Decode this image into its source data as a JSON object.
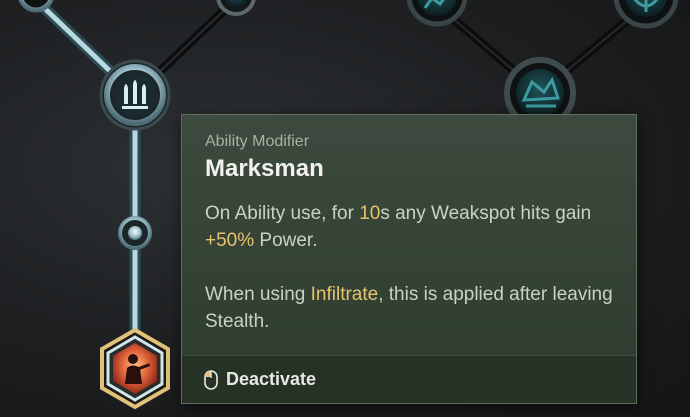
{
  "tooltip": {
    "type_label": "Ability Modifier",
    "title": "Marksman",
    "line1": {
      "t1": "On Ability use, for ",
      "h1": "10",
      "t2": "s any Weakspot hits gain ",
      "h2": "+50%",
      "t3": " Power."
    },
    "line2": {
      "t1": "When using ",
      "h1": "Infiltrate",
      "t2": ", this is applied after leaving Stealth."
    },
    "footer": {
      "icon": "mouse-left-click-icon",
      "label": "Deactivate"
    }
  },
  "skill_tree": {
    "nodes": [
      {
        "name": "top-left-node",
        "state": "active"
      },
      {
        "name": "top-mid-node",
        "state": "locked"
      },
      {
        "name": "top-right-node-1",
        "state": "locked"
      },
      {
        "name": "top-right-node-2",
        "state": "locked"
      },
      {
        "name": "right-node",
        "state": "locked"
      },
      {
        "name": "central-ability-node",
        "state": "active",
        "icon": "bullets-icon"
      },
      {
        "name": "connector-node",
        "state": "active"
      },
      {
        "name": "selected-modifier-node",
        "state": "selected",
        "icon": "marksman-figure-icon"
      }
    ],
    "colors": {
      "active_link": "#b9d8e0",
      "locked_link": "#0c0d0e",
      "teal": "#2f7c80",
      "highlight_gold": "#e6c36e"
    }
  }
}
